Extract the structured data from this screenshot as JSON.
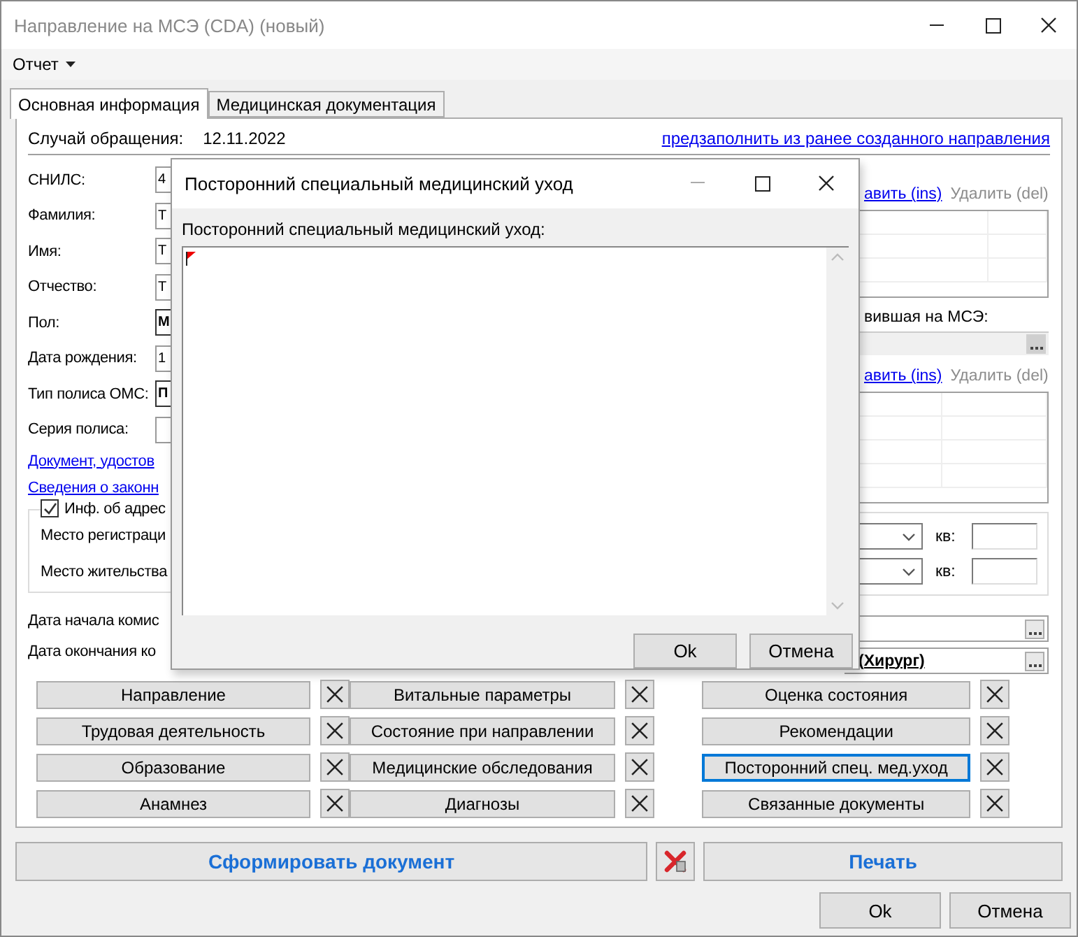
{
  "window": {
    "title": "Направление на МСЭ (CDA) (новый)"
  },
  "menu": [
    {
      "label": "Отчет"
    }
  ],
  "tabs": [
    {
      "label": "Основная информация",
      "selected": true
    },
    {
      "label": "Медицинская документация",
      "selected": false
    }
  ],
  "case": {
    "label": "Случай обращения:",
    "value": "12.11.2022",
    "link": "предзаполнить из ранее созданного направления"
  },
  "left_fields": [
    {
      "label": "СНИЛС:",
      "value": "4",
      "kind": "text"
    },
    {
      "label": "Фамилия:",
      "value": "Т",
      "kind": "text"
    },
    {
      "label": "Имя:",
      "value": "Т",
      "kind": "text"
    },
    {
      "label": "Отчество:",
      "value": "Т",
      "kind": "text"
    },
    {
      "label": "Пол:",
      "value": "М",
      "kind": "combo"
    },
    {
      "label": "Дата рождения:",
      "value": "1",
      "kind": "text"
    },
    {
      "label": "Тип полиса ОМС:",
      "value": "П",
      "kind": "combo"
    },
    {
      "label": "Серия полиса:",
      "kind": "text"
    }
  ],
  "left_links": [
    "Документ, удостов",
    "Сведения о законн"
  ],
  "address": {
    "checkbox": {
      "label": "Инф. об адрес",
      "checked": true
    },
    "rows": [
      {
        "label": "Место регистраци",
        "unit": "кв:"
      },
      {
        "label": "Место жительства",
        "unit": "кв:"
      }
    ]
  },
  "commission": [
    {
      "label": "Дата начала комис"
    },
    {
      "label": "Дата окончания ко",
      "value": "(Хирург)"
    }
  ],
  "right_actions_1": [
    {
      "label": "авить (ins)",
      "disabled": false
    },
    {
      "label": "Удалить (del)",
      "disabled": true
    }
  ],
  "referral_org": {
    "label": "вившая на МСЭ:",
    "disabled": true
  },
  "right_actions_2": [
    {
      "label": "авить (ins)",
      "disabled": false
    },
    {
      "label": "Удалить (del)",
      "disabled": true
    }
  ],
  "doc_sections": [
    [
      {
        "label": "Направление",
        "focused": false
      },
      {
        "label": "Трудовая деятельность",
        "focused": false
      },
      {
        "label": "Образование",
        "focused": false
      },
      {
        "label": "Анамнез",
        "focused": false
      }
    ],
    [
      {
        "label": "Витальные параметры",
        "focused": false
      },
      {
        "label": "Состояние при направлении",
        "focused": false
      },
      {
        "label": "Медицинские обследования",
        "focused": false
      },
      {
        "label": "Диагнозы",
        "focused": false
      }
    ],
    [
      {
        "label": "Оценка состояния",
        "focused": false
      },
      {
        "label": "Рекомендации",
        "focused": false
      },
      {
        "label": "Посторонний спец. мед.уход",
        "focused": true
      },
      {
        "label": "Связанные документы",
        "focused": false
      }
    ]
  ],
  "footer": {
    "generate": "Сформировать документ",
    "print": "Печать"
  },
  "buttons": [
    "Ok",
    "Отмена"
  ],
  "dialog": {
    "title": "Посторонний специальный медицинский уход",
    "field_label": "Посторонний специальный медицинский уход:",
    "buttons": [
      "Ok",
      "Отмена"
    ]
  }
}
